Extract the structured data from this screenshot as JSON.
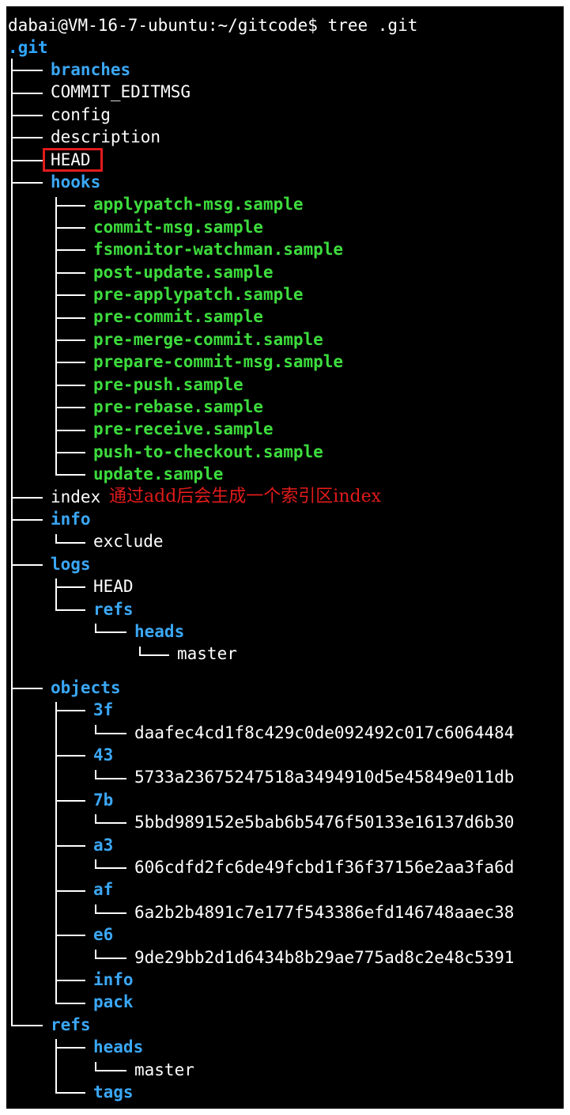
{
  "prompt": "dabai@VM-16-7-ubuntu:~/gitcode$ tree .git",
  "root": ".git",
  "tree": [
    {
      "name": "branches",
      "kind": "dir"
    },
    {
      "name": "COMMIT_EDITMSG",
      "kind": "file"
    },
    {
      "name": "config",
      "kind": "file"
    },
    {
      "name": "description",
      "kind": "file"
    },
    {
      "name": "HEAD",
      "kind": "file",
      "highlighted": true
    },
    {
      "name": "hooks",
      "kind": "dir",
      "children": [
        {
          "name": "applypatch-msg.sample",
          "kind": "exec"
        },
        {
          "name": "commit-msg.sample",
          "kind": "exec"
        },
        {
          "name": "fsmonitor-watchman.sample",
          "kind": "exec"
        },
        {
          "name": "post-update.sample",
          "kind": "exec"
        },
        {
          "name": "pre-applypatch.sample",
          "kind": "exec"
        },
        {
          "name": "pre-commit.sample",
          "kind": "exec"
        },
        {
          "name": "pre-merge-commit.sample",
          "kind": "exec"
        },
        {
          "name": "prepare-commit-msg.sample",
          "kind": "exec"
        },
        {
          "name": "pre-push.sample",
          "kind": "exec"
        },
        {
          "name": "pre-rebase.sample",
          "kind": "exec"
        },
        {
          "name": "pre-receive.sample",
          "kind": "exec"
        },
        {
          "name": "push-to-checkout.sample",
          "kind": "exec"
        },
        {
          "name": "update.sample",
          "kind": "exec"
        }
      ]
    },
    {
      "name": "index",
      "kind": "file",
      "annotation": "通过add后会生成一个索引区index"
    },
    {
      "name": "info",
      "kind": "dir",
      "children": [
        {
          "name": "exclude",
          "kind": "file"
        }
      ]
    },
    {
      "name": "logs",
      "kind": "dir",
      "children": [
        {
          "name": "HEAD",
          "kind": "file"
        },
        {
          "name": "refs",
          "kind": "dir",
          "children": [
            {
              "name": "heads",
              "kind": "dir",
              "children": [
                {
                  "name": "master",
                  "kind": "file"
                }
              ]
            }
          ]
        }
      ]
    },
    {
      "name": "objects",
      "kind": "dir",
      "children": [
        {
          "name": "3f",
          "kind": "dir",
          "children": [
            {
              "name": "daafec4cd1f8c429c0de092492c017c6064484",
              "kind": "file"
            }
          ]
        },
        {
          "name": "43",
          "kind": "dir",
          "children": [
            {
              "name": "5733a23675247518a3494910d5e45849e011db",
              "kind": "file"
            }
          ]
        },
        {
          "name": "7b",
          "kind": "dir",
          "children": [
            {
              "name": "5bbd989152e5bab6b5476f50133e16137d6b30",
              "kind": "file"
            }
          ]
        },
        {
          "name": "a3",
          "kind": "dir",
          "children": [
            {
              "name": "606cdfd2fc6de49fcbd1f36f37156e2aa3fa6d",
              "kind": "file"
            }
          ]
        },
        {
          "name": "af",
          "kind": "dir",
          "children": [
            {
              "name": "6a2b2b4891c7e177f543386efd146748aaec38",
              "kind": "file"
            }
          ]
        },
        {
          "name": "e6",
          "kind": "dir",
          "children": [
            {
              "name": "9de29bb2d1d6434b8b29ae775ad8c2e48c5391",
              "kind": "file"
            }
          ]
        },
        {
          "name": "info",
          "kind": "dir"
        },
        {
          "name": "pack",
          "kind": "dir"
        }
      ]
    },
    {
      "name": "refs",
      "kind": "dir",
      "children": [
        {
          "name": "heads",
          "kind": "dir",
          "children": [
            {
              "name": "master",
              "kind": "file"
            }
          ]
        },
        {
          "name": "tags",
          "kind": "dir"
        }
      ]
    }
  ],
  "colors": {
    "background": "#000000",
    "directory": "#3ba7f5",
    "executable": "#3ddc3d",
    "file": "#ffffff",
    "annotation": "#e21b1b"
  }
}
